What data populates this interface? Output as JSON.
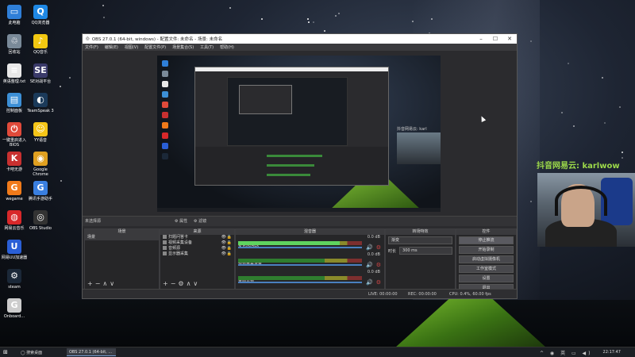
{
  "desktop": {
    "icons": [
      {
        "label": "此电脑",
        "icon": "computer-icon",
        "color": "#2f7fd8",
        "glyph": "▭"
      },
      {
        "label": "QQ浏览器",
        "icon": "qq-browser-icon",
        "color": "#1e88e5",
        "glyph": "Q"
      },
      {
        "label": "回收站",
        "icon": "recycle-bin-icon",
        "color": "#7a8a99",
        "glyph": "♲"
      },
      {
        "label": "QQ音乐",
        "icon": "qq-music-icon",
        "color": "#f2c811",
        "glyph": "♪"
      },
      {
        "label": "英语整理.txt",
        "icon": "text-file-icon",
        "color": "#e8e8e8",
        "glyph": "≡"
      },
      {
        "label": "SE对战平台",
        "icon": "se-platform-icon",
        "color": "#3a3a6a",
        "glyph": "SE"
      },
      {
        "label": "控制面板",
        "icon": "control-panel-icon",
        "color": "#3c8fd6",
        "glyph": "▤"
      },
      {
        "label": "TeamSpeak 3",
        "icon": "teamspeak-icon",
        "color": "#1b3a5a",
        "glyph": "◐"
      },
      {
        "label": "一键重启进入BIOS",
        "icon": "bios-restart-icon",
        "color": "#e04a3a",
        "glyph": "⏻"
      },
      {
        "label": "YY语音",
        "icon": "yy-voice-icon",
        "color": "#f5c518",
        "glyph": "☺"
      },
      {
        "label": "卡吧无游",
        "icon": "kaba-icon",
        "color": "#c83030",
        "glyph": "K"
      },
      {
        "label": "Google Chrome",
        "icon": "chrome-icon",
        "color": "#e0a020",
        "glyph": "◉"
      },
      {
        "label": "wegame",
        "icon": "wegame-icon",
        "color": "#f07a1a",
        "glyph": "G"
      },
      {
        "label": "腾讯手游助手",
        "icon": "tencent-mobile-games-icon",
        "color": "#3a7fe0",
        "glyph": "G"
      },
      {
        "label": "网易云音乐",
        "icon": "netease-music-icon",
        "color": "#d8282a",
        "glyph": "◍"
      },
      {
        "label": "OBS Studio",
        "icon": "obs-studio-icon",
        "color": "#333333",
        "glyph": "◎"
      },
      {
        "label": "网易UU加速器",
        "icon": "uu-accelerator-icon",
        "color": "#2a5fd6",
        "glyph": "U"
      },
      {
        "label": "steam",
        "icon": "steam-icon",
        "color": "#1b2838",
        "glyph": "⚙"
      },
      {
        "label": "Onboard...",
        "icon": "onboard-icon",
        "color": "#cccccc",
        "glyph": "G"
      }
    ]
  },
  "obs": {
    "title": "OBS 27.0.1 (64-bit, windows) - 配置文件: 未命名 - 场景: 未命名",
    "menu": [
      "文件(F)",
      "编辑(E)",
      "视图(V)",
      "配置文件(P)",
      "场景集合(S)",
      "工具(T)",
      "帮助(H)"
    ],
    "no_source_selected": "未选择源",
    "dock_tools": [
      "⚙ 属性",
      "⚙ 滤镜"
    ],
    "scenes": {
      "header": "场景",
      "items": [
        "场景"
      ]
    },
    "sources": {
      "header": "来源",
      "items": [
        "扫题问答卡",
        "视频采集设备",
        "音频源",
        "显示器采集"
      ]
    },
    "mixer": {
      "header": "混音器",
      "channels": [
        {
          "name": "麦克风/Aux",
          "db": "0.0 dB",
          "level": 0.82
        },
        {
          "name": "视频采集设备",
          "db": "0.0 dB",
          "level": 0.0
        },
        {
          "name": "桌面音频",
          "db": "0.0 dB",
          "level": 0.0
        }
      ]
    },
    "transitions": {
      "header": "转场特效",
      "selected": "渐变",
      "duration_label": "时长",
      "duration_value": "300 ms"
    },
    "controls": {
      "header": "控件",
      "buttons": [
        "停止推流",
        "开始录制",
        "启动虚拟摄像机",
        "工作室模式",
        "设置",
        "退出"
      ]
    },
    "status": {
      "live": "LIVE: 00:00:00",
      "rec": "REC: 00:00:00",
      "cpu": "CPU: 0.4%, 60.00 fps"
    },
    "webcam_tag": "抖音网易云: karl"
  },
  "overlay": {
    "caption": "抖音网易云: karlwow"
  },
  "taskbar": {
    "start": "⊞",
    "search": "◯ 搜索桌面",
    "app": "OBS 27.0.1 (64-bit, ...",
    "clock": "22:17:47",
    "tray": "^ ◉ 英 ▭ ◀)"
  }
}
